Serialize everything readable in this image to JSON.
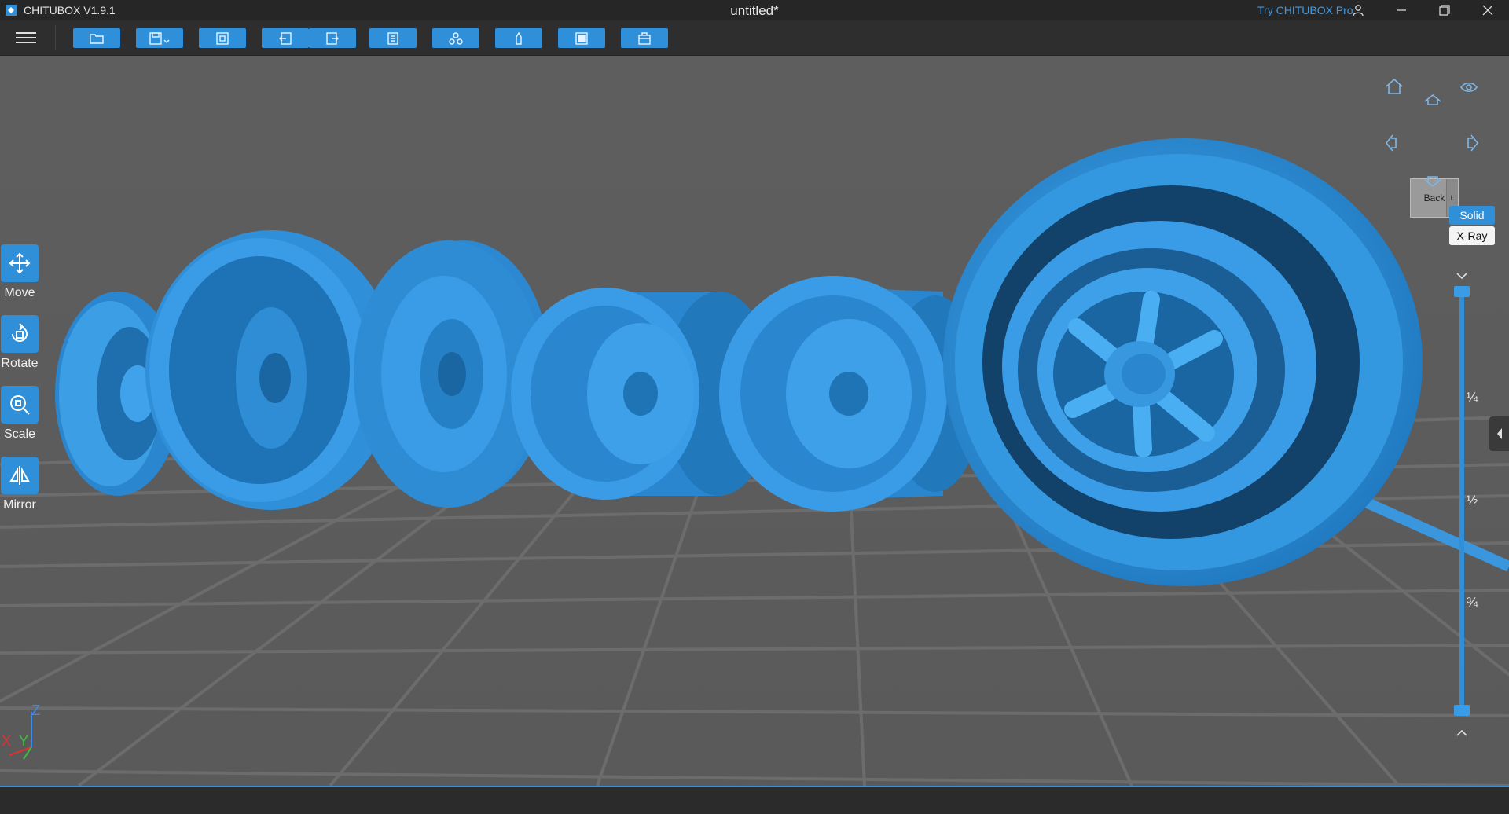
{
  "app": {
    "name": "CHITUBOX V1.9.1",
    "document_title": "untitled*",
    "try_pro": "Try CHITUBOX Pro"
  },
  "toolbar": {
    "tools": [
      {
        "name": "open-file",
        "icon": "folder-icon"
      },
      {
        "name": "save-file",
        "icon": "save-icon"
      },
      {
        "name": "auto-layout",
        "icon": "layout-icon"
      },
      {
        "name": "undo",
        "icon": "undo-icon"
      },
      {
        "name": "redo",
        "icon": "redo-icon"
      },
      {
        "name": "settings",
        "icon": "settings-icon"
      },
      {
        "name": "support",
        "icon": "support-icon"
      },
      {
        "name": "hollow",
        "icon": "hollow-icon"
      },
      {
        "name": "slice",
        "icon": "slice-icon"
      },
      {
        "name": "package",
        "icon": "package-icon"
      }
    ]
  },
  "left_tools": [
    {
      "label": "Move",
      "icon": "move-icon"
    },
    {
      "label": "Rotate",
      "icon": "rotate-icon"
    },
    {
      "label": "Scale",
      "icon": "scale-icon"
    },
    {
      "label": "Mirror",
      "icon": "mirror-icon"
    }
  ],
  "view": {
    "cube_face": "Back",
    "cube_side": "L",
    "modes": {
      "solid": "Solid",
      "xray": "X-Ray"
    },
    "slider_marks": [
      "¼",
      "½",
      "¾"
    ]
  },
  "axes": {
    "x": "X",
    "y": "Y",
    "z": "Z"
  },
  "colors": {
    "accent": "#2f8fd8",
    "model": "#3a9be6",
    "floor": "#595959",
    "grid": "#6e6e6e"
  }
}
